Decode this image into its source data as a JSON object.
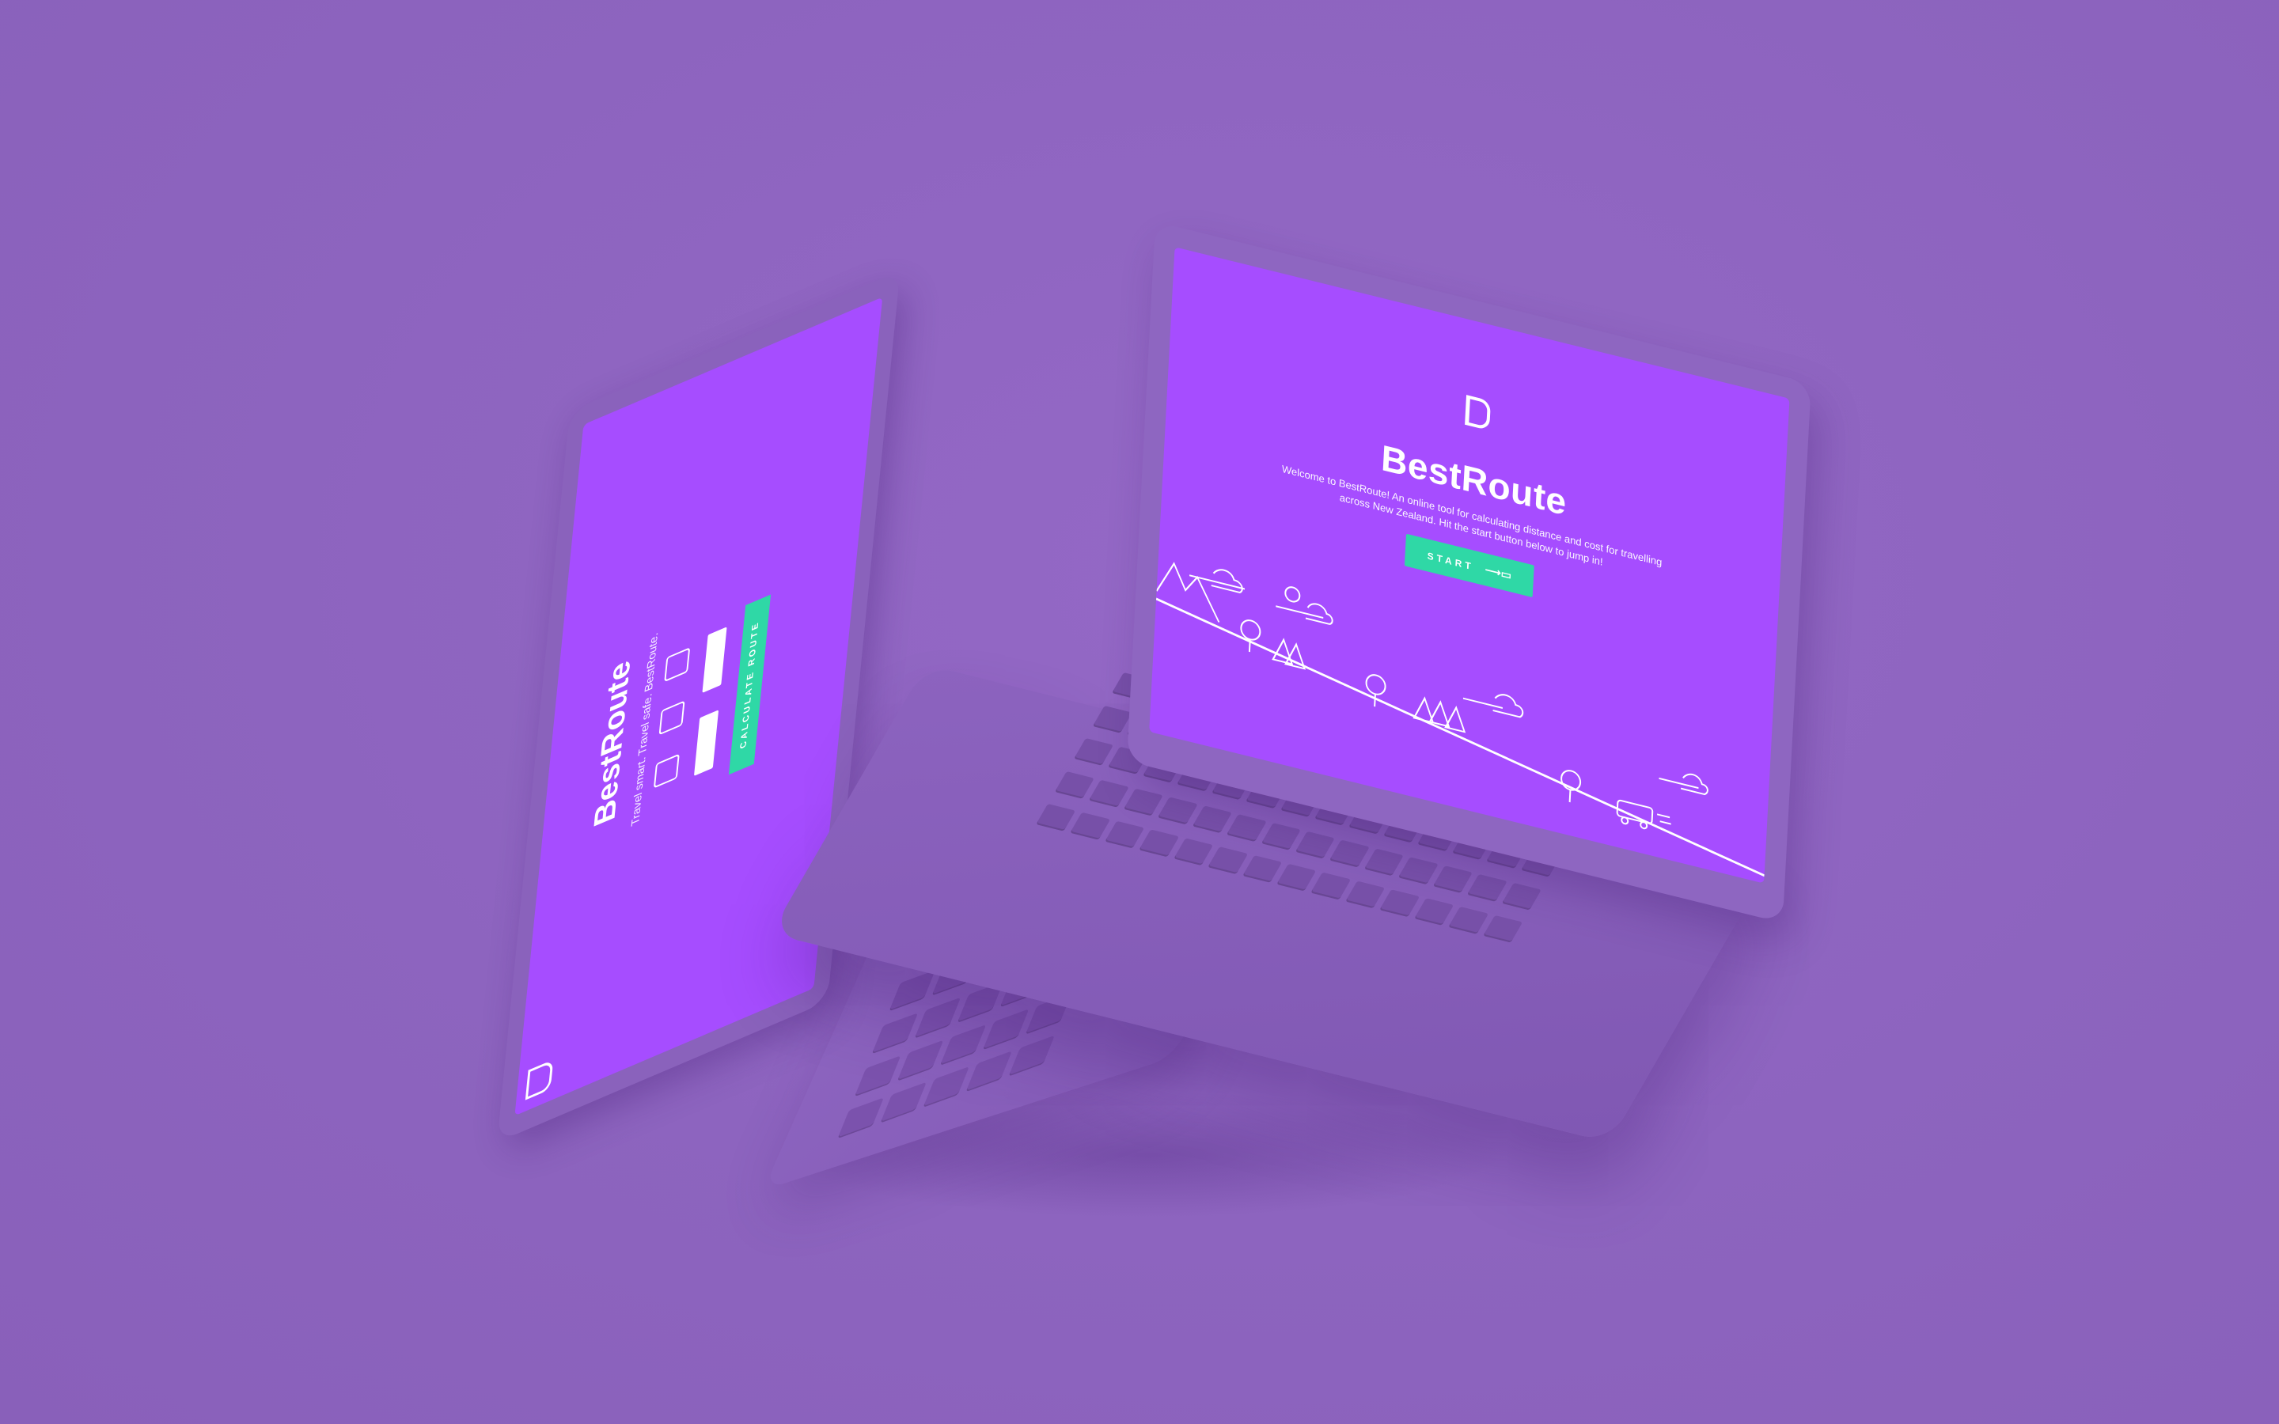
{
  "colors": {
    "background": "#8e65c0",
    "screen": "#a64dff",
    "accent": "#2fd8a6",
    "text": "#ffffff"
  },
  "right_laptop": {
    "screen": {
      "logo_icon": "bestroute-b-logo-icon",
      "title": "BestRoute",
      "intro": "Welcome to BestRoute! An online tool for calculating distance and cost for travelling across New Zealand. Hit the start button below to jump in!",
      "start_button": {
        "label": "START",
        "icon": "campervan-arrow-icon"
      },
      "illustration": [
        "mountain-icon",
        "tree-icon",
        "pine-trees-icon",
        "sun-icon",
        "cloud-icon",
        "campervan-icon"
      ]
    }
  },
  "left_laptop": {
    "screen": {
      "brand": "BestRoute",
      "tagline": "Travel smart. Travel safe. BestRoute.",
      "go_button": "CALCULATE ROUTE",
      "logo_icon": "bestroute-b-logo-icon"
    }
  }
}
